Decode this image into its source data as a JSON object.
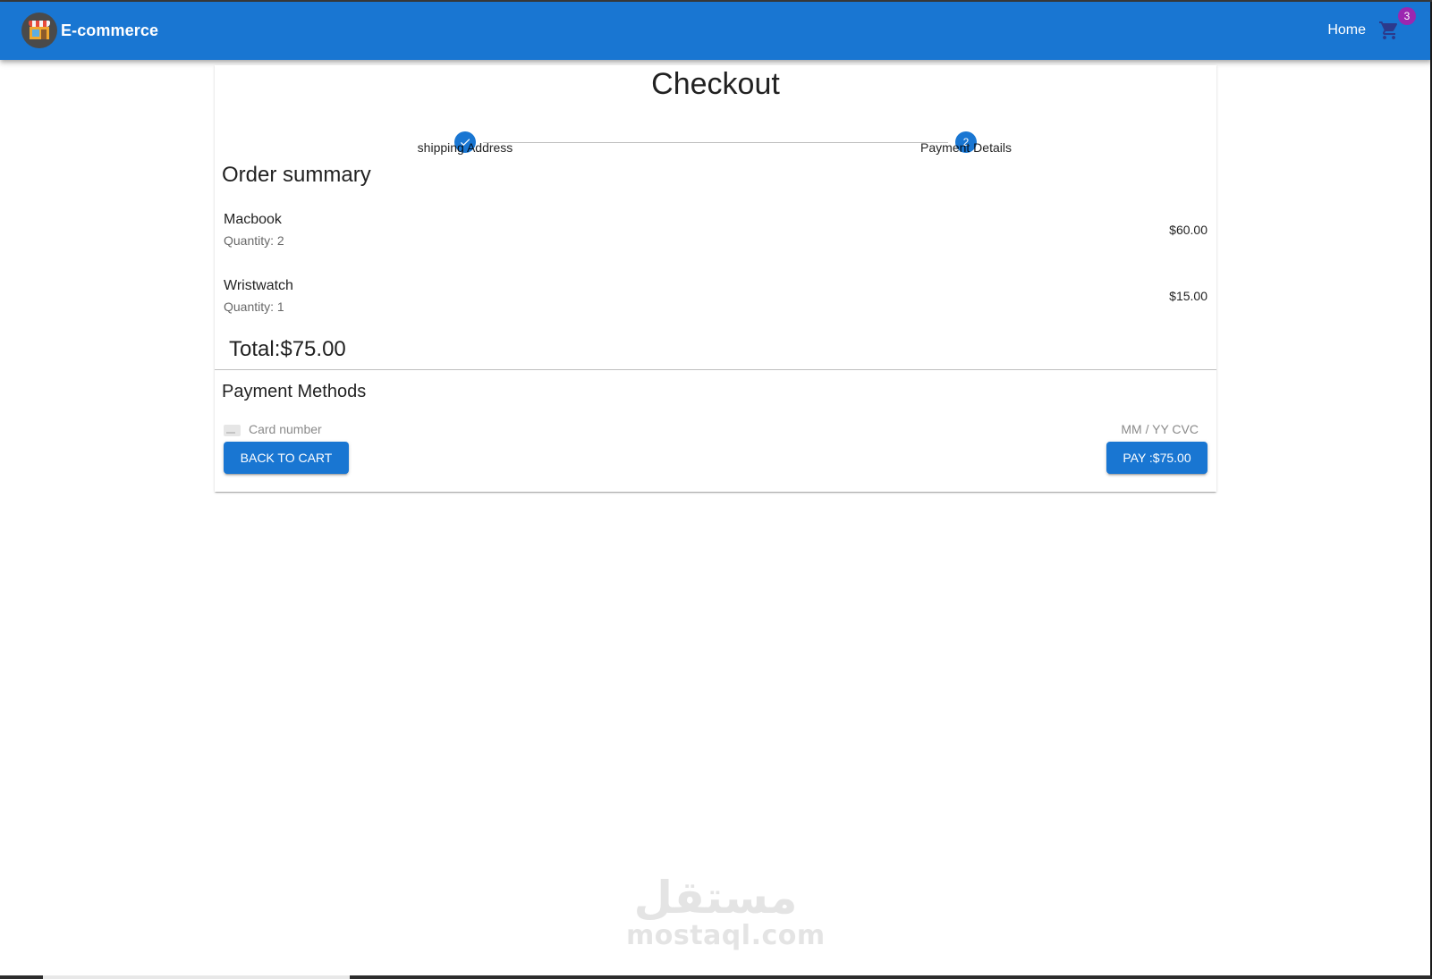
{
  "appbar": {
    "brand": "E-commerce",
    "home_label": "Home",
    "cart_badge": "3",
    "colors": {
      "primary": "#1976d2",
      "badge": "#9c27b0"
    },
    "icons": {
      "logo": "shop-logo-icon",
      "cart": "shopping-cart-icon"
    }
  },
  "checkout": {
    "title": "Checkout",
    "steps": [
      {
        "label": "shipping Address",
        "state": "completed",
        "icon": "check-icon"
      },
      {
        "label": "Payment Details",
        "state": "active",
        "number": "2"
      }
    ]
  },
  "order_summary": {
    "title": "Order summary",
    "items": [
      {
        "name": "Macbook",
        "quantity": "Quantity: 2",
        "price": "$60.00"
      },
      {
        "name": "Wristwatch",
        "quantity": "Quantity: 1",
        "price": "$15.00"
      }
    ],
    "total": "Total:$75.00"
  },
  "payment": {
    "title": "Payment Methods",
    "card_number_placeholder": "Card number",
    "expiry_cvc_placeholder": "MM / YY  CVC",
    "back_button": "Back to cart",
    "pay_button": "PAY :$75.00"
  },
  "watermark": {
    "arabic": "مستقل",
    "latin": "mostaql.com"
  }
}
